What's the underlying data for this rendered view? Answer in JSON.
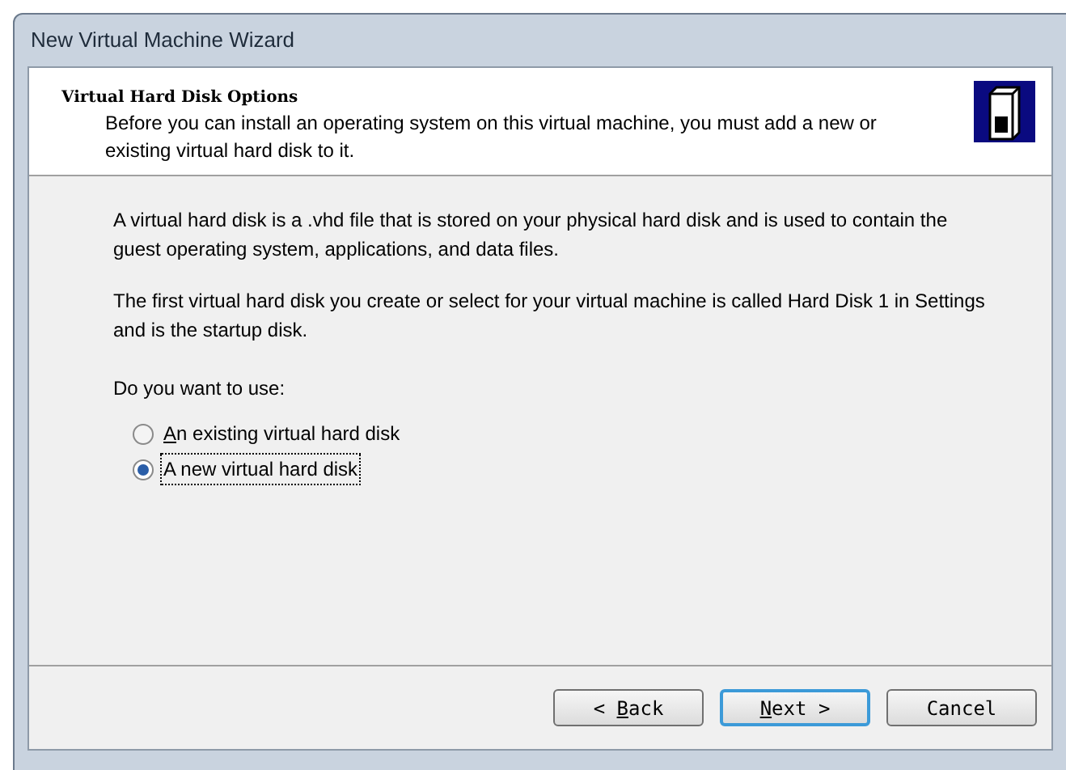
{
  "window": {
    "title": "New Virtual Machine Wizard"
  },
  "header": {
    "title": "Virtual Hard Disk Options",
    "subtitle": "Before you can install an operating system on this virtual machine, you must add a new or existing virtual hard disk to it."
  },
  "body": {
    "paragraphs": [
      "A virtual hard disk is a .vhd file that is stored on your physical hard disk and is used to contain the guest operating system, applications, and data files.",
      "The first virtual hard disk you create or select for your virtual machine is called Hard Disk 1 in Settings and is the startup disk."
    ],
    "question": "Do you want to use:"
  },
  "options": [
    {
      "key": "A",
      "rest": "n existing virtual hard disk",
      "selected": false
    },
    {
      "rest": "A new virtual hard disk",
      "selected": true
    }
  ],
  "buttons": [
    {
      "prefix": "< ",
      "key": "B",
      "rest": "ack",
      "default": false
    },
    {
      "key": "N",
      "rest": "ext >",
      "default": true
    },
    {
      "rest": "Cancel",
      "default": false
    }
  ]
}
